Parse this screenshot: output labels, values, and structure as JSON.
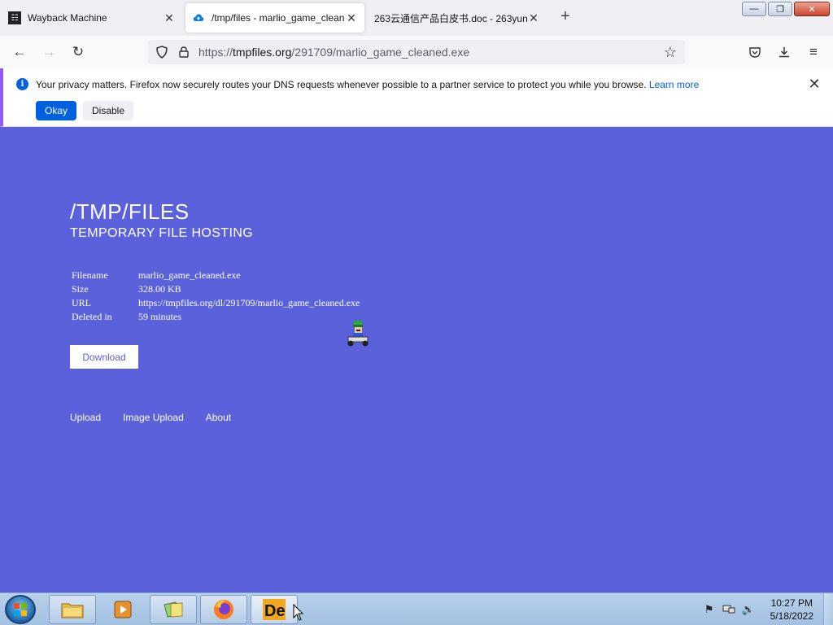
{
  "browser": {
    "tabs": [
      {
        "title": "Wayback Machine",
        "icon": "wayback-icon",
        "active": false
      },
      {
        "title": "/tmp/files - marlio_game_cleaned.exe",
        "icon": "cloud-upload-icon",
        "active": true
      },
      {
        "title": "263云通信产品白皮书.doc - 263yun",
        "icon": "none",
        "active": false
      }
    ],
    "url": {
      "scheme": "https://",
      "host": "tmpfiles.org",
      "path": "/291709/marlio_game_cleaned.exe"
    }
  },
  "notification": {
    "message": "Your privacy matters. Firefox now securely routes your DNS requests whenever possible to a partner service to protect you while you browse.",
    "link": "Learn more",
    "okay_label": "Okay",
    "disable_label": "Disable"
  },
  "page": {
    "title": "/TMP/FILES",
    "subtitle": "TEMPORARY FILE HOSTING",
    "file_info": [
      {
        "key": "Filename",
        "value": "marlio_game_cleaned.exe"
      },
      {
        "key": "Size",
        "value": "328.00 KB"
      },
      {
        "key": "URL",
        "value": "https://tmpfiles.org/dl/291709/marlio_game_cleaned.exe"
      },
      {
        "key": "Deleted in",
        "value": "59 minutes"
      }
    ],
    "download_label": "Download",
    "footer_links": [
      "Upload",
      "Image Upload",
      "About"
    ],
    "background_color": "#5a61da"
  },
  "taskbar": {
    "items": [
      "explorer",
      "media-player",
      "sticky-notes",
      "firefox",
      "de-app"
    ],
    "clock_time": "10:27 PM",
    "clock_date": "5/18/2022"
  }
}
